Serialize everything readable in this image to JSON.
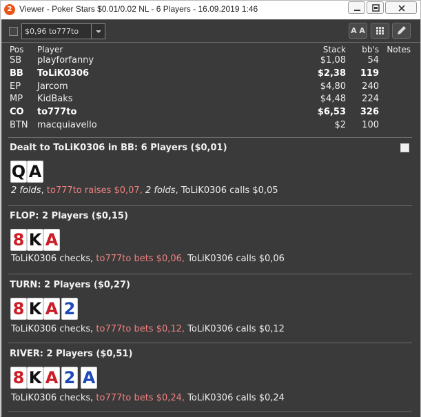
{
  "window": {
    "title": "Viewer - Poker Stars $0.01/0.02 NL - 6 Players - 16.09.2019 1:46",
    "app_icon": "2"
  },
  "toolbar": {
    "hand_select_value": "$0,96 to777to",
    "font_button_label": "A A",
    "icons": [
      "checkbox-icon",
      "chevron-down-icon",
      "font-size-icon",
      "grid-icon",
      "pencil-icon"
    ]
  },
  "players": {
    "headers": {
      "pos": "Pos",
      "player": "Player",
      "stack": "Stack",
      "bbs": "bb's",
      "notes": "Notes"
    },
    "rows": [
      {
        "pos": "SB",
        "player": "playforfanny",
        "stack": "$1,08",
        "bbs": "54"
      },
      {
        "pos": "BB",
        "player": "ToLiK0306",
        "stack": "$2,38",
        "bbs": "119"
      },
      {
        "pos": "EP",
        "player": "Jarcom",
        "stack": "$4,80",
        "bbs": "240"
      },
      {
        "pos": "MP",
        "player": "KidBaks",
        "stack": "$4,48",
        "bbs": "224"
      },
      {
        "pos": "CO",
        "player": "to777to",
        "stack": "$6,53",
        "bbs": "326"
      },
      {
        "pos": "BTN",
        "player": "macquiavello",
        "stack": "$2",
        "bbs": "100"
      }
    ]
  },
  "streets": {
    "preflop": {
      "title": "Dealt to ToLiK0306 in BB: 6 Players ($0,01)",
      "cards": [
        {
          "rank": "Q",
          "suit": "s"
        },
        {
          "rank": "A",
          "suit": "s"
        }
      ],
      "a1": "2 folds",
      "a1_sep": ", ",
      "a2": "to777to raises $0,07,",
      "a2_sep": " ",
      "a3": "2 folds",
      "a3_sep": ", ",
      "a4": "ToLiK0306 calls $0,05"
    },
    "flop": {
      "title": "FLOP: 2 Players ($0,15)",
      "cards": [
        {
          "rank": "8",
          "suit": "h"
        },
        {
          "rank": "K",
          "suit": "s"
        },
        {
          "rank": "A",
          "suit": "h"
        }
      ],
      "a1": "ToLiK0306 checks,",
      "a2": "to777to bets $0,06,",
      "a3": "ToLiK0306 calls $0,06"
    },
    "turn": {
      "title": "TURN: 2 Players ($0,27)",
      "cards": [
        {
          "rank": "8",
          "suit": "h"
        },
        {
          "rank": "K",
          "suit": "s"
        },
        {
          "rank": "A",
          "suit": "h"
        },
        {
          "rank": "2",
          "suit": "d"
        }
      ],
      "a1": "ToLiK0306 checks,",
      "a2": "to777to bets $0,12,",
      "a3": "ToLiK0306 calls $0,12"
    },
    "river": {
      "title": "RIVER: 2 Players ($0,51)",
      "cards": [
        {
          "rank": "8",
          "suit": "h"
        },
        {
          "rank": "K",
          "suit": "s"
        },
        {
          "rank": "A",
          "suit": "h"
        },
        {
          "rank": "2",
          "suit": "d"
        },
        {
          "rank": "A",
          "suit": "d"
        }
      ],
      "a1": "ToLiK0306 checks,",
      "a2": "to777to bets $0,24,",
      "a3": "ToLiK0306 calls $0,24"
    }
  },
  "colors": {
    "background": "#3a3a3a",
    "highlight": "#f08080",
    "hearts": "#cc1d27",
    "diamonds": "#1e4ab8",
    "spades": "#111111"
  }
}
